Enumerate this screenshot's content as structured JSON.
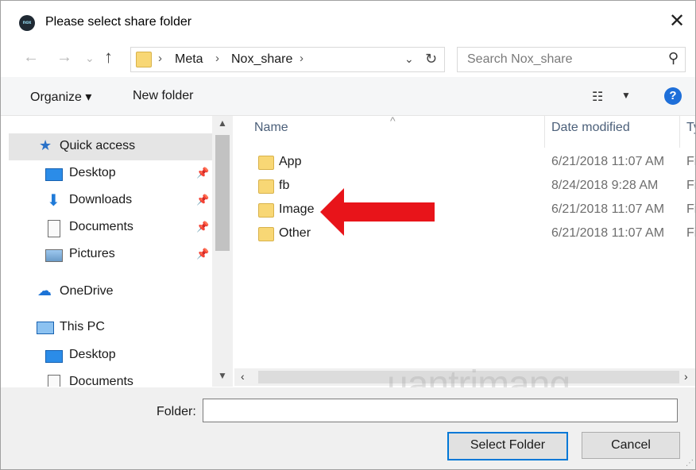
{
  "window": {
    "title": "Please select share folder",
    "app_icon_text": "nox"
  },
  "nav": {
    "back": "←",
    "forward": "→",
    "recent": "⌄",
    "up": "↑",
    "breadcrumbs": [
      "Meta",
      "Nox_share"
    ],
    "search_placeholder": "Search Nox_share"
  },
  "toolbar": {
    "organize": "Organize",
    "new_folder": "New folder"
  },
  "sidebar": {
    "items": [
      {
        "label": "Quick access",
        "icon": "star-icon",
        "selected": true
      },
      {
        "label": "Desktop",
        "icon": "desktop-icon",
        "pinned": true
      },
      {
        "label": "Downloads",
        "icon": "download-icon",
        "pinned": true
      },
      {
        "label": "Documents",
        "icon": "documents-icon",
        "pinned": true
      },
      {
        "label": "Pictures",
        "icon": "pictures-icon",
        "pinned": true
      },
      {
        "label": "OneDrive",
        "icon": "cloud-icon"
      },
      {
        "label": "This PC",
        "icon": "computer-icon"
      },
      {
        "label": "Desktop",
        "icon": "desktop-icon"
      },
      {
        "label": "Documents",
        "icon": "documents-icon"
      }
    ]
  },
  "files": {
    "columns": {
      "name": "Name",
      "date": "Date modified",
      "type": "Ty"
    },
    "rows": [
      {
        "name": "App",
        "date": "6/21/2018 11:07 AM",
        "type": "Fi"
      },
      {
        "name": "fb",
        "date": "8/24/2018 9:28 AM",
        "type": "Fi"
      },
      {
        "name": "Image",
        "date": "6/21/2018 11:07 AM",
        "type": "Fi"
      },
      {
        "name": "Other",
        "date": "6/21/2018 11:07 AM",
        "type": "Fi"
      }
    ]
  },
  "footer": {
    "folder_label": "Folder:",
    "folder_value": "",
    "select_button": "Select Folder",
    "cancel_button": "Cancel"
  },
  "watermark": "uantrimang",
  "colors": {
    "accent": "#0078d7",
    "arrow": "#e8141a",
    "folder": "#f8d775"
  }
}
